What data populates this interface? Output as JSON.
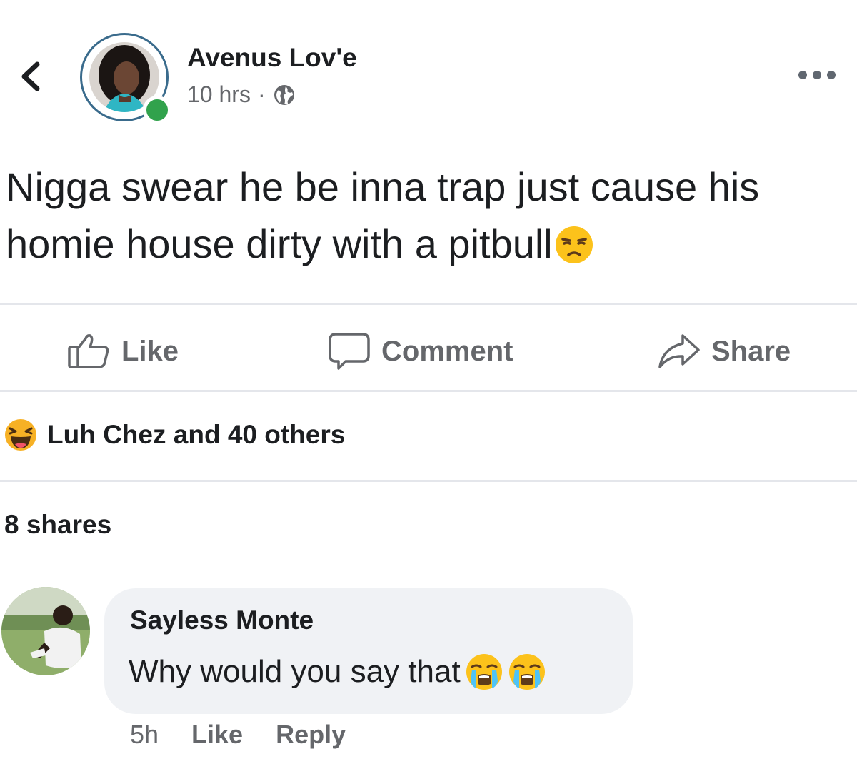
{
  "header": {
    "author_name": "Avenus Lov'e",
    "time": "10 hrs",
    "separator": "·",
    "privacy_icon": "globe-icon"
  },
  "post": {
    "text": "Nigga swear he be inna trap just cause his homie house dirty with a pitbull",
    "emoji": "unamused-face-icon"
  },
  "actions": {
    "like_label": "Like",
    "comment_label": "Comment",
    "share_label": "Share"
  },
  "reactions": {
    "icon": "haha-reaction-icon",
    "text": "Luh Chez and 40 others"
  },
  "shares": "8 shares",
  "comment": {
    "author": "Sayless Monte",
    "text": "Why would you say that",
    "emojis": [
      "loudly-crying-face-icon",
      "loudly-crying-face-icon"
    ],
    "time": "5h",
    "like_label": "Like",
    "reply_label": "Reply"
  },
  "colors": {
    "text": "#1c1e21",
    "secondary": "#65676b",
    "divider": "#e4e6eb",
    "bubble": "#f0f2f5",
    "online": "#31a24c"
  }
}
